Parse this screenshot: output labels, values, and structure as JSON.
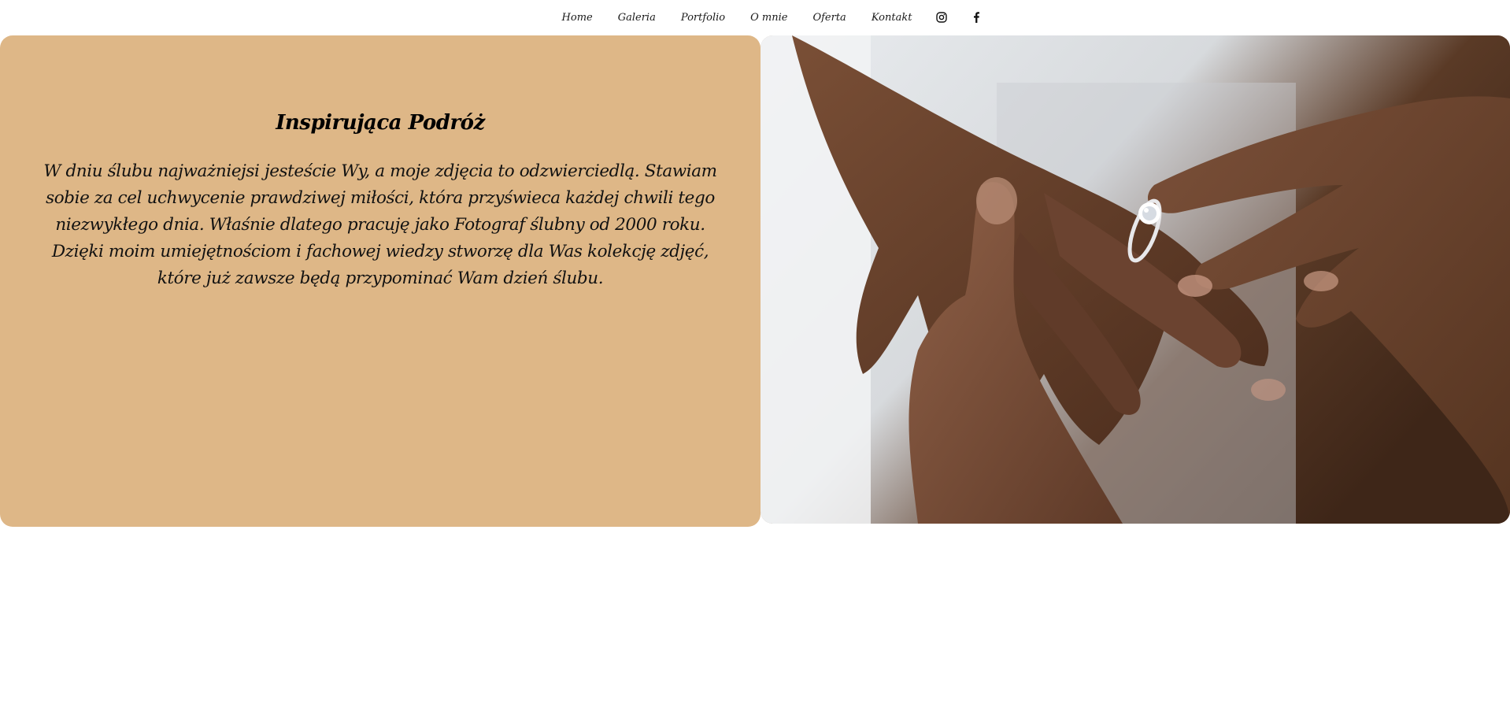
{
  "nav": {
    "links": [
      "Home",
      "Galeria",
      "Portfolio",
      "O mnie",
      "Oferta",
      "Kontakt"
    ],
    "icons": [
      "instagram-icon",
      "facebook-icon"
    ]
  },
  "intro": {
    "title": "Inspirująca Podróż",
    "body": "W dniu ślubu najważniejsi jesteście Wy, a moje zdjęcia to odzwierciedlą. Stawiam sobie za cel uchwycenie prawdziwej miłości, która przyświeca każdej chwili tego niezwykłego dnia. Właśnie dlatego pracuję jako Fotograf ślubny od 2000 roku. Dzięki moim umiejętnościom i fachowej wiedzy stworzę dla Was kolekcję zdjęć, które już zawsze będą przypominać Wam dzień ślubu."
  },
  "photo": {
    "subject": "wedding-ring-hands-photo"
  },
  "colors": {
    "card_background": "#deb787",
    "page_background": "#ffffff",
    "text": "#000000"
  }
}
